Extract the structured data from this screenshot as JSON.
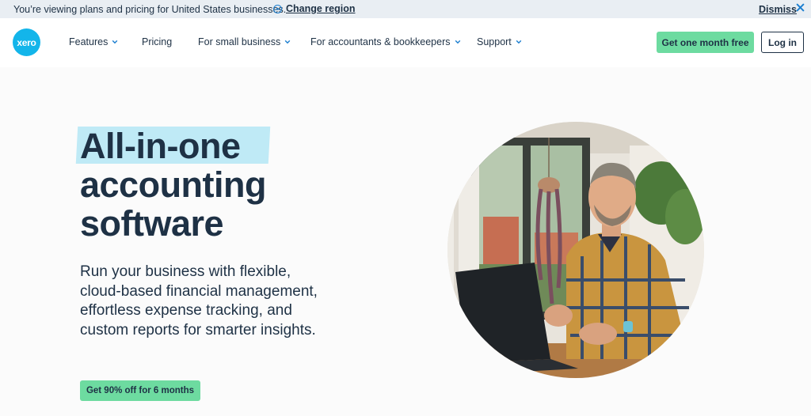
{
  "banner": {
    "message": "You’re viewing plans and pricing for United States businesses.",
    "change_region": "Change region",
    "dismiss": "Dismiss"
  },
  "nav": {
    "logo_text": "xero",
    "items": [
      {
        "label": "Features"
      },
      {
        "label": "Pricing"
      },
      {
        "label": "For small business"
      },
      {
        "label": "For accountants & bookkeepers"
      },
      {
        "label": "Support"
      }
    ],
    "cta": "Get one month free",
    "login": "Log in"
  },
  "hero": {
    "headline": [
      "All-in-one",
      "accounting",
      "software"
    ],
    "subtext": "Run your business with flexible, cloud-based financial management, effortless expense tracking, and custom reports for smarter insights.",
    "offer_button": "Get 90% off for 6 months"
  },
  "colors": {
    "brand": "#13b5ea",
    "cta_green": "#6ddba0",
    "navy": "#1e3145",
    "highlight": "#bfeaf6",
    "banner_bg": "#e9eef3"
  },
  "icons": {
    "change_region": "chevron-up-circle-icon",
    "dismiss": "close-icon",
    "dropdown": "chevron-down-icon"
  }
}
